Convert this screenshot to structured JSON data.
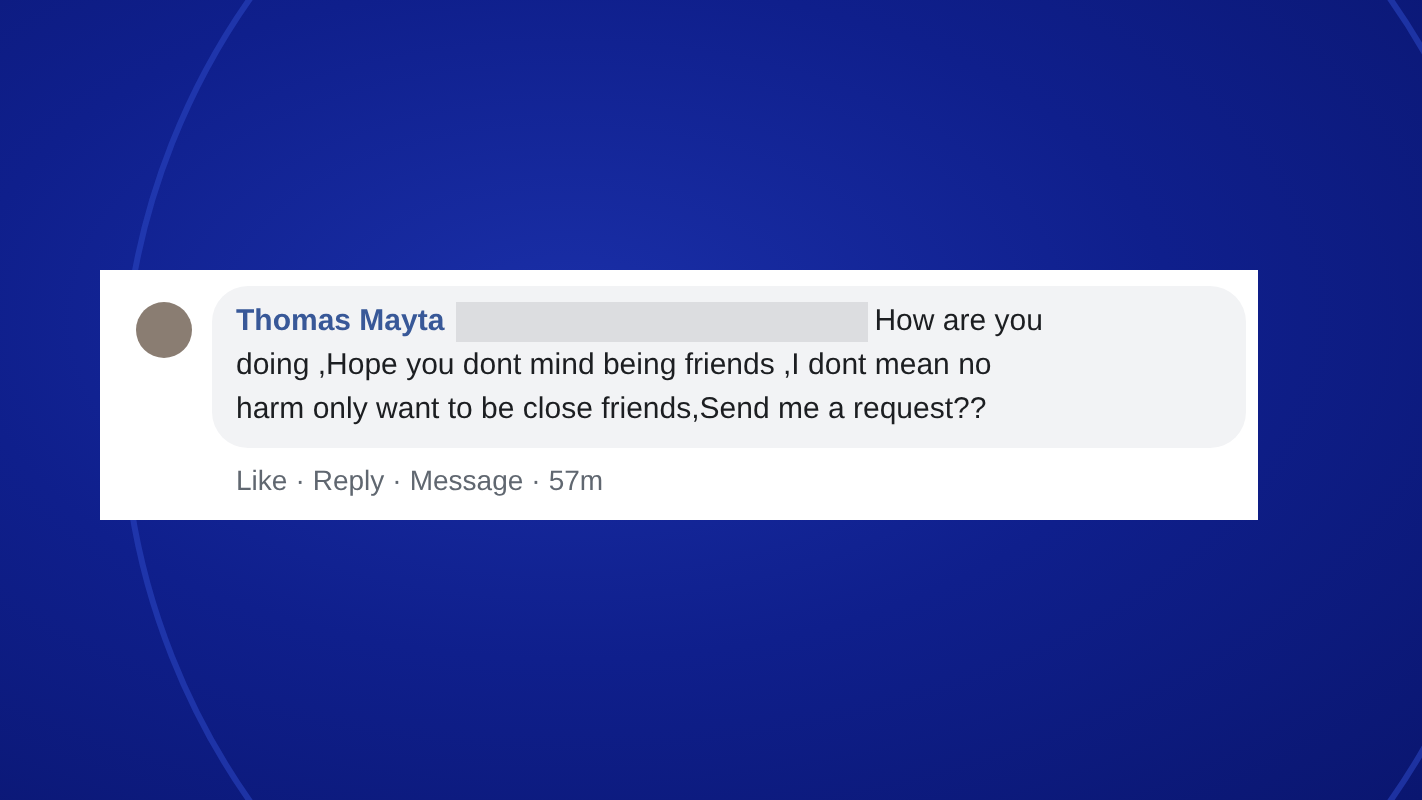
{
  "comment": {
    "author": "Thomas Mayta",
    "message_lines": [
      "How are you",
      "doing ,Hope you dont mind being friends ,I dont mean no",
      "harm only want to be close friends,Send me a request??"
    ],
    "actions": [
      {
        "label": "Like"
      },
      {
        "label": "Reply"
      },
      {
        "label": "Message"
      }
    ],
    "separator": "·",
    "time": "57m"
  }
}
